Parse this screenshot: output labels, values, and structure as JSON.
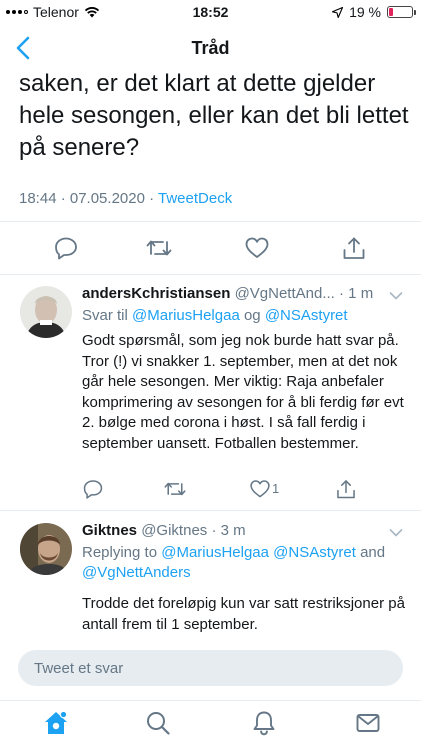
{
  "status_bar": {
    "carrier": "Telenor",
    "time": "18:52",
    "battery": "19 %",
    "battery_level": 0.19,
    "battery_color": "#e0245e"
  },
  "nav": {
    "title": "Tråd",
    "back_icon": "chevron-left-icon"
  },
  "main_tweet": {
    "text": "saken, er det klart at dette gjelder hele sesongen, eller kan det bli lettet på senere?",
    "timestamp": "18:44 · 07.05.2020 · ",
    "source": "TweetDeck",
    "actions": [
      "reply-icon",
      "retweet-icon",
      "like-icon",
      "share-icon"
    ]
  },
  "replies": [
    {
      "name": "andersKchristiansen",
      "handle": "@VgNettAnd...",
      "time": "· 1 m",
      "reply_prefix": "Svar til ",
      "mention_1": "@MariusHelgaa",
      "reply_joiner": " og ",
      "mention_2": "@NSAstyret",
      "text": "Godt spørsmål, som jeg nok burde hatt svar på. Tror (!) vi snakker 1. september, men at det nok går hele sesongen. Mer viktig: Raja anbefaler komprimering av sesongen for å bli ferdig før evt 2. bølge med corona i høst. I så fall ferdig i september uansett. Fotballen bestemmer.",
      "like_count": "1"
    },
    {
      "name": "Giktnes",
      "handle": "@Giktnes",
      "time": "· 3 m",
      "reply_prefix": "Replying to ",
      "mention_1": "@MariusHelgaa",
      "mention_2": "@NSAstyret",
      "reply_joiner": " and ",
      "mention_3": "@VgNettAnders",
      "text": "Trodde det foreløpig kun var satt restriksjoner på antall frem til 1 september."
    }
  ],
  "composer": {
    "placeholder": "Tweet et svar"
  },
  "tab_bar": [
    "home-icon",
    "search-icon",
    "notifications-icon",
    "messages-icon"
  ],
  "colors": {
    "accent": "#1da1f2",
    "secondary_text": "#657786",
    "divider": "#e6ecf0"
  }
}
